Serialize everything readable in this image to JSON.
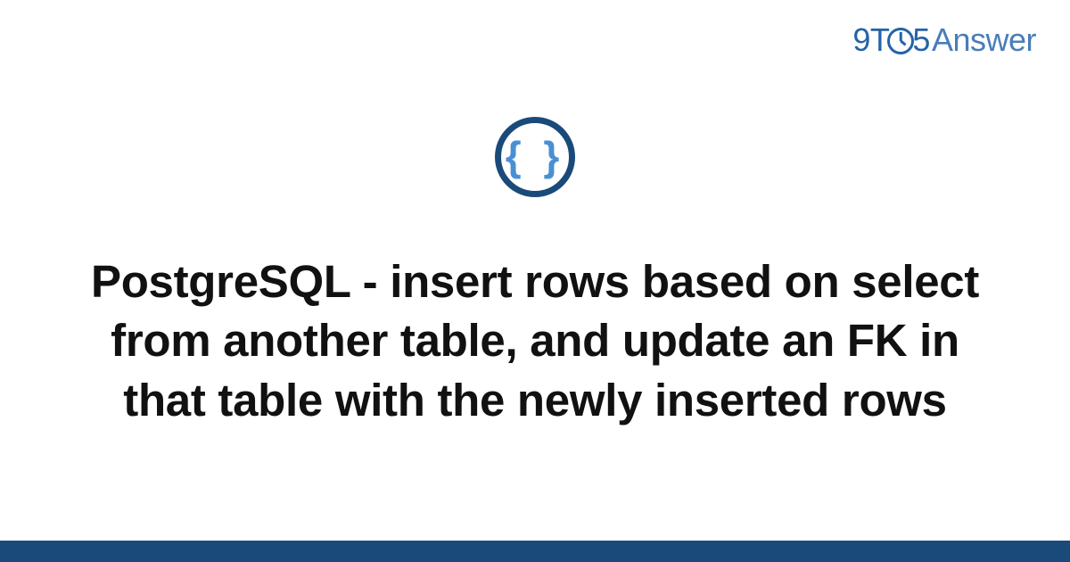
{
  "logo": {
    "nine": "9",
    "t": "T",
    "five": "5",
    "answer": "Answer"
  },
  "icon": {
    "braces": "{ }"
  },
  "title": "PostgreSQL - insert rows based on select from another table, and update an FK in that table with the newly inserted rows"
}
